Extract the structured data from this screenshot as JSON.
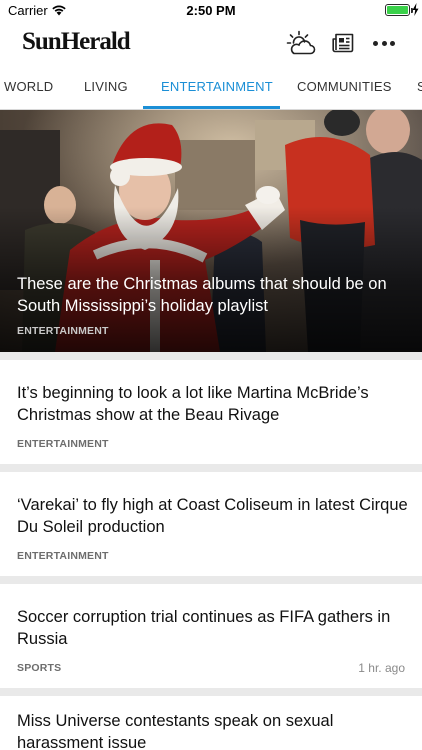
{
  "status_bar": {
    "carrier": "Carrier",
    "time": "2:50 PM"
  },
  "header": {
    "logo": "SunHerald",
    "icons": [
      "weather-icon",
      "newspaper-icon",
      "more-icon"
    ]
  },
  "tabs": [
    {
      "label": "WORLD"
    },
    {
      "label": "LIVING"
    },
    {
      "label": "ENTERTAINMENT",
      "active": true
    },
    {
      "label": "COMMUNITIES"
    },
    {
      "label": "S"
    }
  ],
  "hero": {
    "title": "These are the Christmas albums that should be on South Mississippi’s holiday playlist",
    "category": "ENTERTAINMENT"
  },
  "articles": [
    {
      "title": "It’s beginning to look a lot like Martina McBride’s Christmas show at the Beau Rivage",
      "category": "ENTERTAINMENT",
      "time": ""
    },
    {
      "title": "‘Varekai’ to fly high at Coast Coliseum in latest Cirque Du Soleil production",
      "category": "ENTERTAINMENT",
      "time": ""
    },
    {
      "title": "Soccer corruption trial continues as FIFA gathers in Russia",
      "category": "SPORTS",
      "time": "1 hr. ago"
    },
    {
      "title": "Miss Universe contestants speak on sexual harassment issue",
      "category": "",
      "time": ""
    }
  ],
  "colors": {
    "accent": "#1b8fd6",
    "battery": "#3ad14a"
  }
}
